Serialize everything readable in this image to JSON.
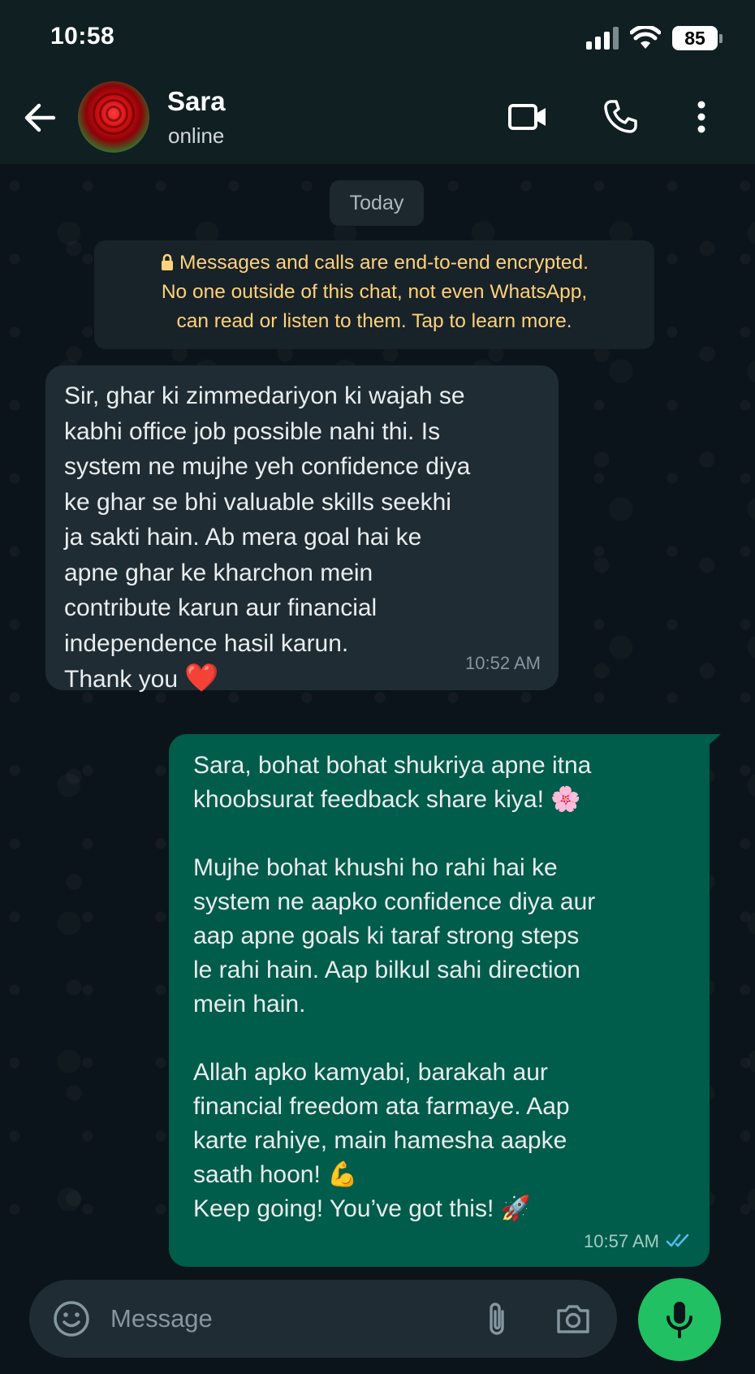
{
  "status_bar": {
    "time": "10:58",
    "battery_level": "85"
  },
  "header": {
    "contact_name": "Sara",
    "contact_status": "online",
    "icons": [
      "back-arrow-icon",
      "video-camera-icon",
      "phone-icon",
      "more-vertical-icon"
    ]
  },
  "chat": {
    "date_chip": "Today",
    "encryption_notice": {
      "lines": [
        "Messages and calls are end-to-end encrypted.",
        "No one outside of this chat, not even WhatsApp,",
        "can read or listen to them. Tap to learn more."
      ]
    },
    "messages": [
      {
        "direction": "incoming",
        "lines": [
          "Sir, ghar ki zimmedariyon ki wajah se",
          "kabhi office job possible nahi thi. Is",
          "system ne mujhe yeh confidence diya",
          "ke ghar se bhi valuable skills seekhi",
          "ja sakti hain. Ab mera goal hai ke",
          "apne ghar ke kharchon mein",
          "contribute karun aur financial",
          "independence hasil karun.",
          "Thank you "
        ],
        "emoji": "❤️",
        "time": "10:52 AM"
      },
      {
        "direction": "outgoing",
        "lines": [
          "Sara, bohat bohat shukriya apne itna",
          "khoobsurat feedback share kiya! 🌸",
          "",
          "Mujhe bohat khushi ho rahi hai ke",
          "system ne aapko confidence diya aur",
          "aap apne goals ki taraf strong steps",
          "le rahi hain. Aap bilkul sahi direction",
          "mein hain.",
          "",
          "Allah apko kamyabi, barakah aur",
          "financial freedom ata farmaye. Aap",
          "karte rahiye, main hamesha aapke",
          "saath hoon! 💪",
          "Keep going! You’ve got this! 🚀"
        ],
        "time": "10:57 AM",
        "read_status": "double-check-blue-icon"
      }
    ]
  },
  "composer": {
    "placeholder": "Message",
    "icons": [
      "emoji-icon",
      "paperclip-icon",
      "camera-icon",
      "microphone-icon"
    ]
  },
  "colors": {
    "header_bg": "#0f1f22",
    "chat_bg": "#0b141a",
    "incoming_bubble": "#1f2c33",
    "outgoing_bubble": "#005c4b",
    "notice_text": "#ffd279",
    "mic_button": "#21c063",
    "read_ticks": "#53bdeb"
  }
}
